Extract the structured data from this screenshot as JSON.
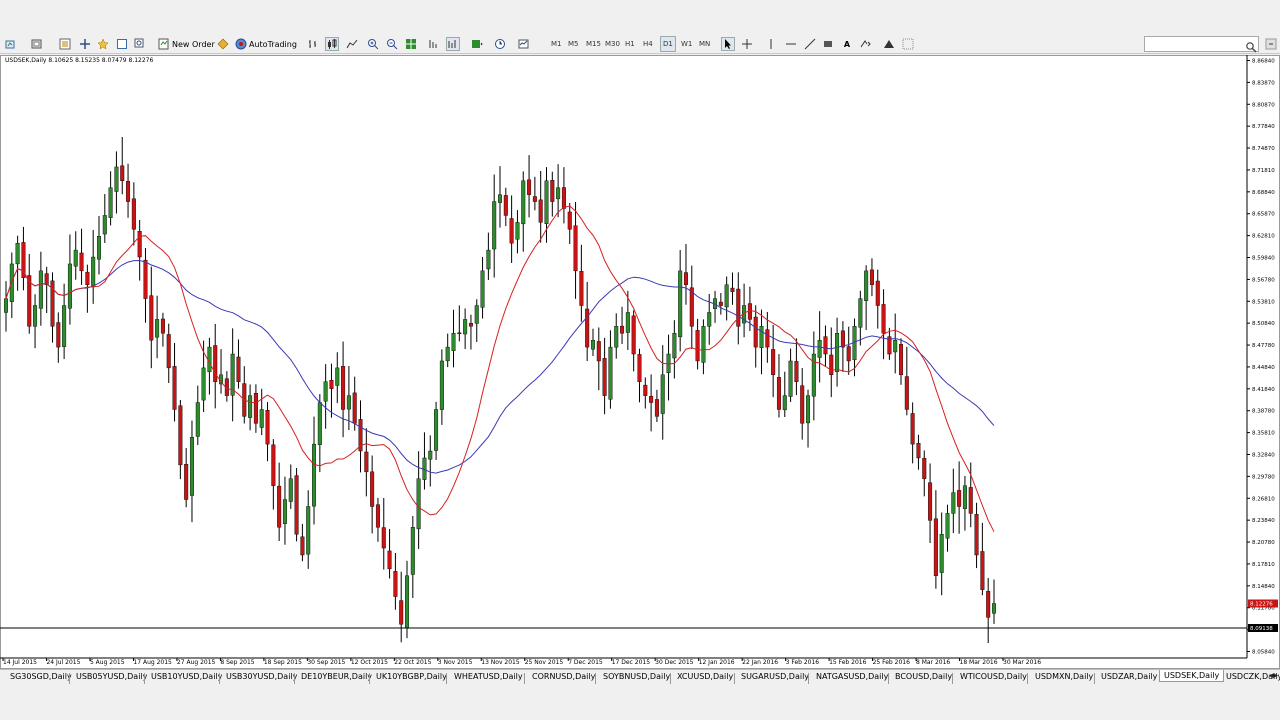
{
  "toolbar": {
    "new_order_label": "New Order",
    "autotrading_label": "AutoTrading",
    "timeframes": [
      "M1",
      "M5",
      "M15",
      "M30",
      "H1",
      "H4",
      "D1",
      "W1",
      "MN"
    ],
    "active_timeframe": "D1"
  },
  "chart": {
    "symbol_line": "USDSEK,Daily  8.10625 8.15235 8.07479 8.12276",
    "colors": {
      "bull": "#2e8b2e",
      "bear": "#c81414",
      "wick": "#000000",
      "ma_fast": "#d62020",
      "ma_slow": "#3a3ab4",
      "bid_label_bg": "#c81414",
      "ask_label_bg": "#000000"
    },
    "bid_label": "8.12276",
    "ask_label": "8.09138"
  },
  "chart_data": {
    "type": "candlestick",
    "title": "",
    "xlabel": "",
    "ylabel": "",
    "ylim": [
      8.05,
      8.9
    ],
    "price_ticks": [
      "8.86840",
      "8.83870",
      "8.80870",
      "8.77840",
      "8.74870",
      "8.71810",
      "8.68840",
      "8.65870",
      "8.62810",
      "8.59840",
      "8.56780",
      "8.53810",
      "8.50840",
      "8.47780",
      "8.44840",
      "8.41840",
      "8.38780",
      "8.35810",
      "8.32840",
      "8.29780",
      "8.26810",
      "8.23840",
      "8.20780",
      "8.17810",
      "8.14840",
      "8.11780",
      "8.08810",
      "8.05840"
    ],
    "date_ticks": [
      "14 Jul 2015",
      "24 Jul 2015",
      "5 Aug 2015",
      "17 Aug 2015",
      "27 Aug 2015",
      "8 Sep 2015",
      "18 Sep 2015",
      "30 Sep 2015",
      "12 Oct 2015",
      "22 Oct 2015",
      "3 Nov 2015",
      "13 Nov 2015",
      "25 Nov 2015",
      "7 Dec 2015",
      "17 Dec 2015",
      "30 Dec 2015",
      "12 Jan 2016",
      "22 Jan 2016",
      "3 Feb 2016",
      "15 Feb 2016",
      "25 Feb 2016",
      "8 Mar 2016",
      "18 Mar 2016",
      "30 Mar 2016"
    ],
    "close": [
      8.56,
      8.61,
      8.64,
      8.59,
      8.52,
      8.55,
      8.6,
      8.58,
      8.52,
      8.49,
      8.55,
      8.61,
      8.63,
      8.6,
      8.58,
      8.62,
      8.65,
      8.68,
      8.72,
      8.75,
      8.73,
      8.7,
      8.66,
      8.62,
      8.56,
      8.5,
      8.53,
      8.51,
      8.46,
      8.4,
      8.32,
      8.27,
      8.36,
      8.41,
      8.46,
      8.49,
      8.44,
      8.45,
      8.42,
      8.48,
      8.44,
      8.39,
      8.42,
      8.38,
      8.4,
      8.35,
      8.29,
      8.23,
      8.27,
      8.3,
      8.22,
      8.19,
      8.26,
      8.35,
      8.41,
      8.44,
      8.43,
      8.46,
      8.4,
      8.42,
      8.38,
      8.34,
      8.31,
      8.26,
      8.23,
      8.2,
      8.17,
      8.13,
      8.09,
      8.16,
      8.23,
      8.3,
      8.33,
      8.34,
      8.4,
      8.47,
      8.49,
      8.51,
      8.51,
      8.53,
      8.52,
      8.55,
      8.6,
      8.63,
      8.7,
      8.71,
      8.68,
      8.64,
      8.67,
      8.73,
      8.71,
      8.7,
      8.67,
      8.73,
      8.7,
      8.72,
      8.69,
      8.66,
      8.6,
      8.55,
      8.49,
      8.5,
      8.47,
      8.42,
      8.49,
      8.52,
      8.51,
      8.54,
      8.48,
      8.44,
      8.42,
      8.41,
      8.39,
      8.45,
      8.48,
      8.51,
      8.6,
      8.58,
      8.52,
      8.47,
      8.52,
      8.54,
      8.56,
      8.55,
      8.58,
      8.57,
      8.52,
      8.55,
      8.53,
      8.49,
      8.52,
      8.49,
      8.45,
      8.4,
      8.42,
      8.47,
      8.44,
      8.38,
      8.42,
      8.48,
      8.5,
      8.48,
      8.45,
      8.51,
      8.49,
      8.47,
      8.52,
      8.56,
      8.6,
      8.58,
      8.55,
      8.51,
      8.48,
      8.5,
      8.45,
      8.4,
      8.35,
      8.33,
      8.3,
      8.24,
      8.16,
      8.22,
      8.25,
      8.28,
      8.26,
      8.29,
      8.25,
      8.19,
      8.14,
      8.1,
      8.12
    ],
    "series": [
      {
        "name": "",
        "role": "fast moving average"
      },
      {
        "name": "",
        "role": "slow moving average"
      }
    ]
  },
  "tabs": {
    "items": [
      "SG30SGD,Daily",
      "USB05YUSD,Daily",
      "USB10YUSD,Daily",
      "USB30YUSD,Daily",
      "DE10YBEUR,Daily",
      "UK10YBGBP,Daily",
      "WHEATUSD,Daily",
      "CORNUSD,Daily",
      "SOYBNUSD,Daily",
      "XCUUSD,Daily",
      "SUGARUSD,Daily",
      "NATGASUSD,Daily",
      "BCOUSD,Daily",
      "WTICOUSD,Daily",
      "USDMXN,Daily",
      "USDZAR,Daily",
      "USDSEK,Daily",
      "USDCZK,Daily"
    ],
    "active": "USDSEK,Daily"
  }
}
